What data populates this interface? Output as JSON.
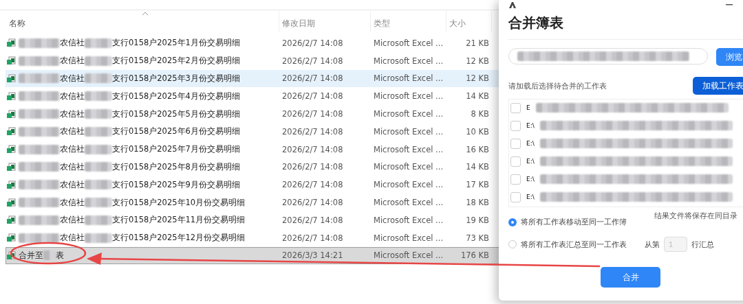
{
  "explorer": {
    "columns": [
      {
        "label": "名称",
        "sorted": true
      },
      {
        "label": "修改日期",
        "sorted": false
      },
      {
        "label": "类型",
        "sorted": false
      },
      {
        "label": "大小",
        "sorted": false
      }
    ],
    "files": [
      {
        "name_parts": [
          "农信社",
          "支行0158户2025年1月份交易明细"
        ],
        "modified": "2026/2/7 14:08",
        "type": "Microsoft Excel ...",
        "size": "21 KB",
        "hovered": false,
        "selected": false
      },
      {
        "name_parts": [
          "农信社",
          "支行0158户2025年2月份交易明细"
        ],
        "modified": "2026/2/7 14:08",
        "type": "Microsoft Excel ...",
        "size": "12 KB",
        "hovered": false,
        "selected": false
      },
      {
        "name_parts": [
          "农信社",
          "支行0158户2025年3月份交易明细"
        ],
        "modified": "2026/2/7 14:08",
        "type": "Microsoft Excel ...",
        "size": "12 KB",
        "hovered": true,
        "selected": false
      },
      {
        "name_parts": [
          "农信社",
          "支行0158户2025年4月份交易明细"
        ],
        "modified": "2026/2/7 14:08",
        "type": "Microsoft Excel ...",
        "size": "14 KB",
        "hovered": false,
        "selected": false
      },
      {
        "name_parts": [
          "农信社",
          "支行0158户2025年5月份交易明细"
        ],
        "modified": "2026/2/7 14:08",
        "type": "Microsoft Excel ...",
        "size": "8 KB",
        "hovered": false,
        "selected": false
      },
      {
        "name_parts": [
          "农信社",
          "支行0158户2025年6月份交易明细"
        ],
        "modified": "2026/2/7 14:08",
        "type": "Microsoft Excel ...",
        "size": "10 KB",
        "hovered": false,
        "selected": false
      },
      {
        "name_parts": [
          "农信社",
          "支行0158户2025年7月份交易明细"
        ],
        "modified": "2026/2/7 14:08",
        "type": "Microsoft Excel ...",
        "size": "16 KB",
        "hovered": false,
        "selected": false
      },
      {
        "name_parts": [
          "农信社",
          "支行0158户2025年8月份交易明细"
        ],
        "modified": "2026/2/7 14:08",
        "type": "Microsoft Excel ...",
        "size": "14 KB",
        "hovered": false,
        "selected": false
      },
      {
        "name_parts": [
          "农信社",
          "支行0158户2025年9月份交易明细"
        ],
        "modified": "2026/2/7 14:08",
        "type": "Microsoft Excel ...",
        "size": "17 KB",
        "hovered": false,
        "selected": false
      },
      {
        "name_parts": [
          "农信社",
          "支行0158户2025年10月份交易明细"
        ],
        "modified": "2026/2/7 14:08",
        "type": "Microsoft Excel ...",
        "size": "18 KB",
        "hovered": false,
        "selected": false
      },
      {
        "name_parts": [
          "农信社",
          "支行0158户2025年11月份交易明细"
        ],
        "modified": "2026/2/7 14:08",
        "type": "Microsoft Excel ...",
        "size": "19 KB",
        "hovered": false,
        "selected": false
      },
      {
        "name_parts": [
          "农信社",
          "支行0158户2025年12月份交易明细"
        ],
        "modified": "2026/2/7 14:08",
        "type": "Microsoft Excel ...",
        "size": "73 KB",
        "hovered": false,
        "selected": false
      },
      {
        "name_parts": [
          "合并至",
          "表"
        ],
        "modified": "2026/3/3 14:21",
        "type": "Microsoft Excel ...",
        "size": "176 KB",
        "hovered": false,
        "selected": true
      }
    ]
  },
  "dialog": {
    "title": "合并簿表",
    "browse_button": "浏览",
    "sheet_prompt": "请加载后选择待合并的工作表",
    "load_button": "加载工作表",
    "sheets": [
      {
        "path": "E",
        "checked": false
      },
      {
        "path": "E:\\",
        "checked": false
      },
      {
        "path": "E:\\",
        "checked": false
      },
      {
        "path": "E:\\",
        "checked": false
      },
      {
        "path": "E:\\",
        "checked": false
      },
      {
        "path": "E:\\",
        "checked": false
      }
    ],
    "modes": [
      {
        "label": "将所有工作表移动至同一工作簿",
        "selected": true
      },
      {
        "label": "将所有工作表汇总至同一工作表",
        "selected": false
      }
    ],
    "save_note": "结果文件将保存在同目录",
    "from_label": "从第",
    "start_row": "1",
    "to_label": "行汇总",
    "merge_button": "合并"
  }
}
